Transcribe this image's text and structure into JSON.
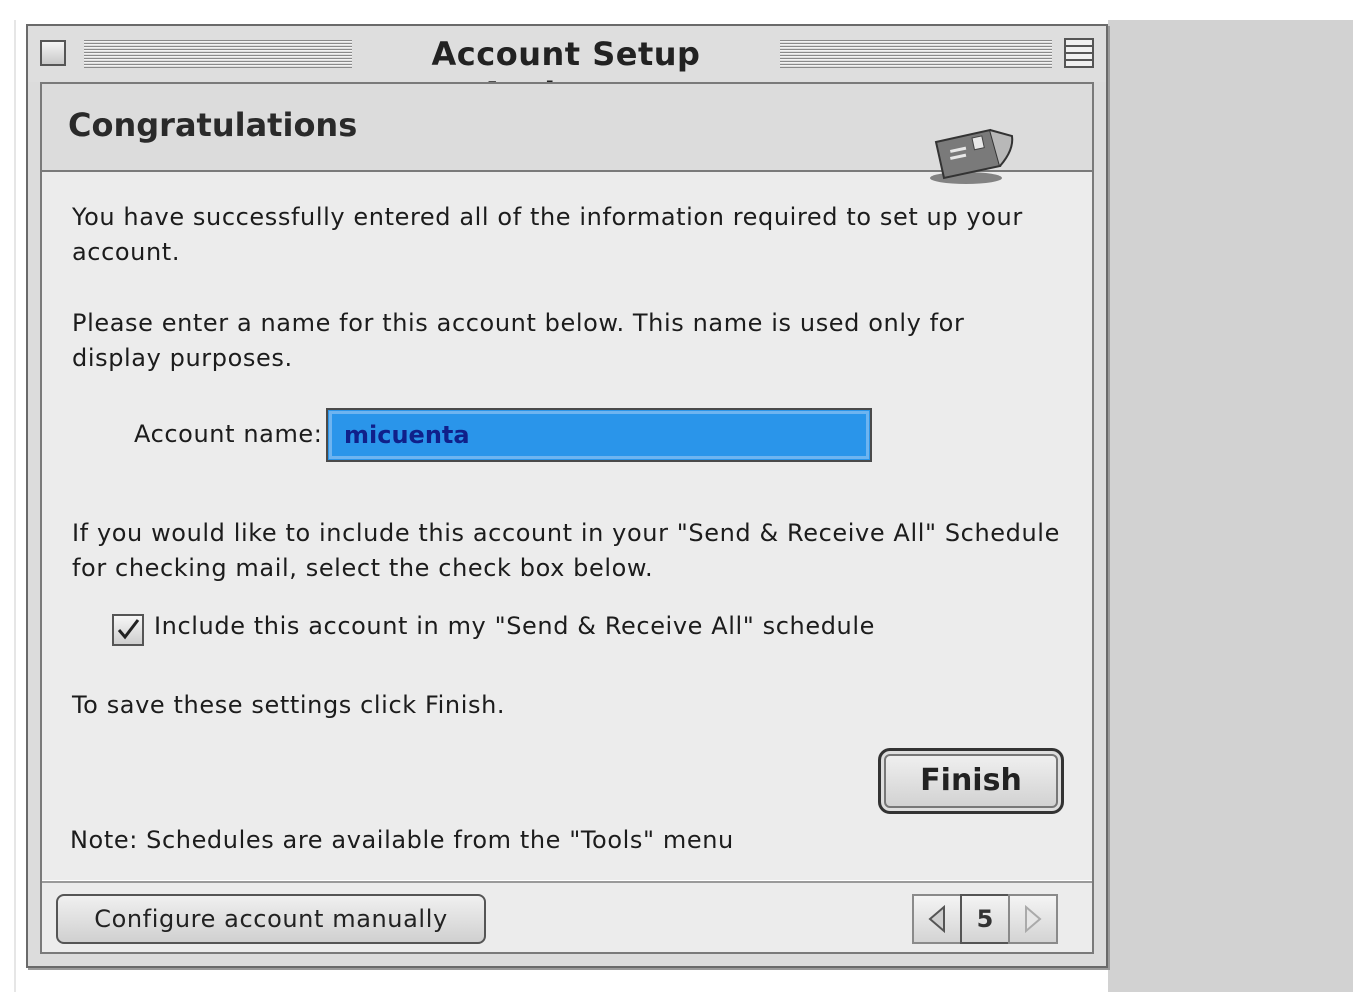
{
  "window": {
    "title": "Account Setup Assistant"
  },
  "header": {
    "title": "Congratulations",
    "icon": "mail-envelope-icon"
  },
  "body": {
    "intro_text": "You have successfully entered all of the information required to set up your account.",
    "name_instruction": "Please enter a name for this account below. This name is used only for display purposes.",
    "account_name_label": "Account name:",
    "account_name_value": "micuenta",
    "schedule_instruction": "If you would like to include this account in your \"Send & Receive All\" Schedule for checking mail, select the check box below.",
    "include_checkbox_label": "Include this account in my \"Send & Receive All\" schedule",
    "include_checked": true,
    "save_instruction": "To save these settings click Finish.",
    "finish_label": "Finish",
    "note_text": "Note: Schedules are available from the \"Tools\" menu"
  },
  "footer": {
    "configure_manually_label": "Configure account manually",
    "page_number": "5"
  },
  "colors": {
    "selection_blue": "#2a95ea",
    "selected_text": "#10208a"
  }
}
